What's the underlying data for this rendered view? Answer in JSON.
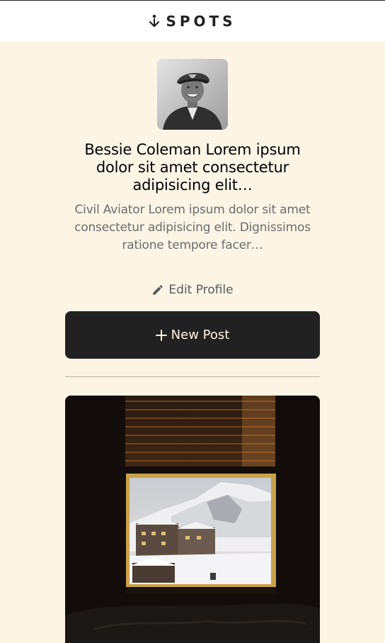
{
  "header": {
    "logo_text": "SPOTS",
    "logo_icon": "spots-logo-icon"
  },
  "profile": {
    "avatar_icon": "avatar-photo",
    "name": "Bessie Coleman Lorem ipsum dolor sit amet consectetur adipisicing elit…",
    "description": "Civil Aviator Lorem ipsum dolor sit amet consectetur adipisicing elit. Dignissimos ratione tempore facer…",
    "edit_label": "Edit Profile",
    "edit_icon": "pencil-icon"
  },
  "actions": {
    "new_post_label": "New Post",
    "new_post_icon": "plus-icon"
  },
  "colors": {
    "background": "#FCF5E5",
    "button": "#212121",
    "text_secondary": "#6B6B6B"
  }
}
